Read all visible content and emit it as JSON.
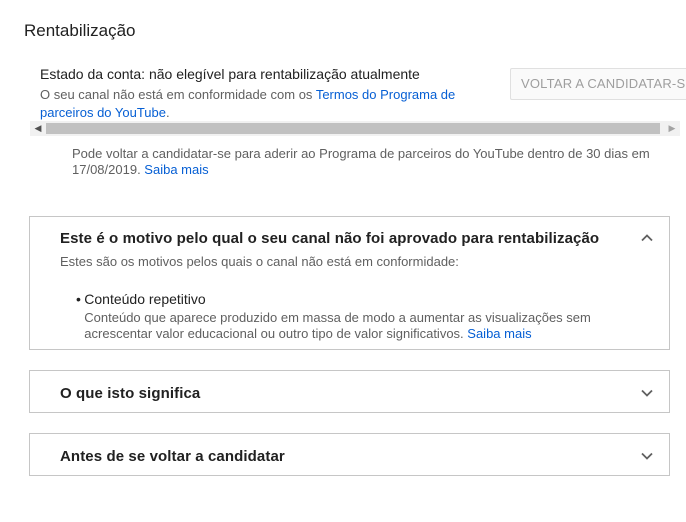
{
  "page": {
    "title": "Rentabilização"
  },
  "account_status": {
    "status_line": "Estado da conta: não elegível para rentabilização atualmente",
    "desc_prefix": "O seu canal não está em conformidade com os ",
    "desc_link": "Termos do Programa de parceiros do YouTube",
    "desc_suffix": ".",
    "reapply_button": "VOLTAR A CANDIDATAR-SE"
  },
  "reapply_note": {
    "text": "Pode voltar a candidatar-se para aderir ao Programa de parceiros do YouTube dentro de 30 dias em 17/08/2019. ",
    "link": "Saiba mais"
  },
  "panels": [
    {
      "title": "Este é o motivo pelo qual o seu canal não foi aprovado para rentabilização",
      "expanded": true,
      "intro": "Estes são os motivos pelos quais o canal não está em conformidade:",
      "reasons": [
        {
          "bullet": "•",
          "title": "Conteúdo repetitivo",
          "desc": "Conteúdo que aparece produzido em massa de modo a aumentar as visualizações sem acrescentar valor educacional ou outro tipo de valor significativos.  ",
          "link": "Saiba mais"
        }
      ]
    },
    {
      "title": "O que isto significa",
      "expanded": false
    },
    {
      "title": "Antes de se voltar a candidatar",
      "expanded": false
    }
  ],
  "scrollbar": {
    "left_arrow": "◀",
    "right_arrow": "▶"
  },
  "colors": {
    "link": "#065fd4",
    "border": "#c6c6c6",
    "secondary_text": "#606060"
  }
}
